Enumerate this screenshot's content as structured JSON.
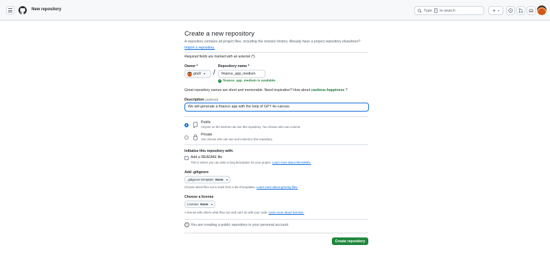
{
  "header": {
    "title": "New repository",
    "search_prefix": "Type",
    "search_key": "/",
    "search_suffix": "to search",
    "plus_label": "+",
    "plus_caret": "▾"
  },
  "main": {
    "heading": "Create a new repository",
    "intro_text": "A repository contains all project files, including the revision history. Already have a project repository elsewhere?",
    "import_link": "Import a repository.",
    "required_prefix": "Required fields are marked with an asterisk (*).",
    "owner_label": "Owner *",
    "owner_value": "gncll",
    "slash": "/",
    "repo_label": "Repository name *",
    "repo_value": "finance_app_medium",
    "available_text": "finance_app_medium is available.",
    "great_text": "Great repository names are short and memorable. Need inspiration? How about",
    "suggestion": "cautious-happiness",
    "great_suffix": "?",
    "desc_label": "Description",
    "desc_optional": "(optional)",
    "desc_value": "We will generate a finance app with the help of GPT 4o-canvas.",
    "public_title": "Public",
    "public_sub": "Anyone on the internet can see this repository. You choose who can commit.",
    "private_title": "Private",
    "private_sub": "You choose who can see and commit to this repository.",
    "init_label": "Initialize this repository with:",
    "readme_title": "Add a README file",
    "readme_sub": "This is where you can write a long description for your project.",
    "readme_link": "Learn more about READMEs.",
    "gitignore_label": "Add .gitignore",
    "gitignore_dd_prefix": ".gitignore template:",
    "gitignore_dd_value": "None",
    "gitignore_sub": "Choose which files not to track from a list of templates.",
    "gitignore_link": "Learn more about ignoring files.",
    "license_label": "Choose a license",
    "license_dd_prefix": "License:",
    "license_dd_value": "None",
    "license_sub": "A license tells others what they can and can't do with your code.",
    "license_link": "Learn more about licenses.",
    "note": "You are creating a public repository in your personal account.",
    "create_button": "Create repository"
  },
  "colors": {
    "accent": "#0969da",
    "success": "#1a7f37",
    "primary_button": "#1f883d"
  },
  "icons": [
    "hamburger-icon",
    "github-logo-icon",
    "search-icon",
    "plus-icon",
    "issues-icon",
    "pull-request-icon",
    "inbox-icon",
    "check-circle-icon",
    "repo-icon",
    "lock-icon",
    "info-icon"
  ]
}
